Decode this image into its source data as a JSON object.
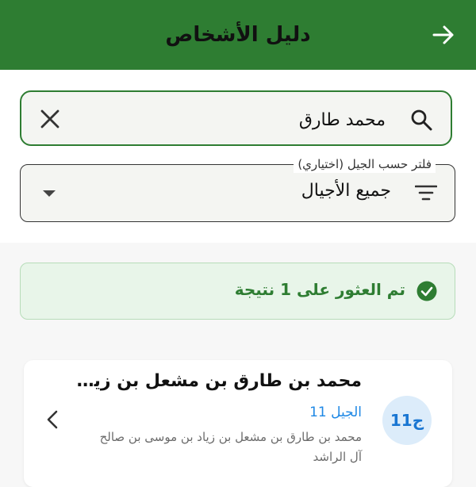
{
  "appbar": {
    "title": "دليل الأشخاص"
  },
  "search": {
    "value": "محمد طارق",
    "placeholder": ""
  },
  "generation_filter": {
    "label": "فلتر حسب الجيل (اختياري)",
    "selected": "جميع الأجيال"
  },
  "results": {
    "summary": "تم العثور على 1 نتيجة"
  },
  "people": [
    {
      "avatar": "ج11",
      "name": "محمد بن طارق بن مشعل بن زياد بن موسى بن صالح آل الراشد",
      "generation": "الجيل 11",
      "full_name": "محمد بن طارق بن مشعل بن زياد بن موسى بن صالح آل الراشد"
    }
  ],
  "colors": {
    "primary": "#2e7d32",
    "success_bg": "#e8f5e9",
    "generation_accent": "#1e88e5",
    "avatar_bg": "#dcecfa"
  },
  "icons": {
    "back": "arrow-right-icon",
    "search": "search-icon",
    "clear": "close-icon",
    "filter": "filter-list-icon",
    "dropdown": "dropdown-arrow-icon",
    "success": "check-circle-icon",
    "open": "chevron-left-icon"
  }
}
